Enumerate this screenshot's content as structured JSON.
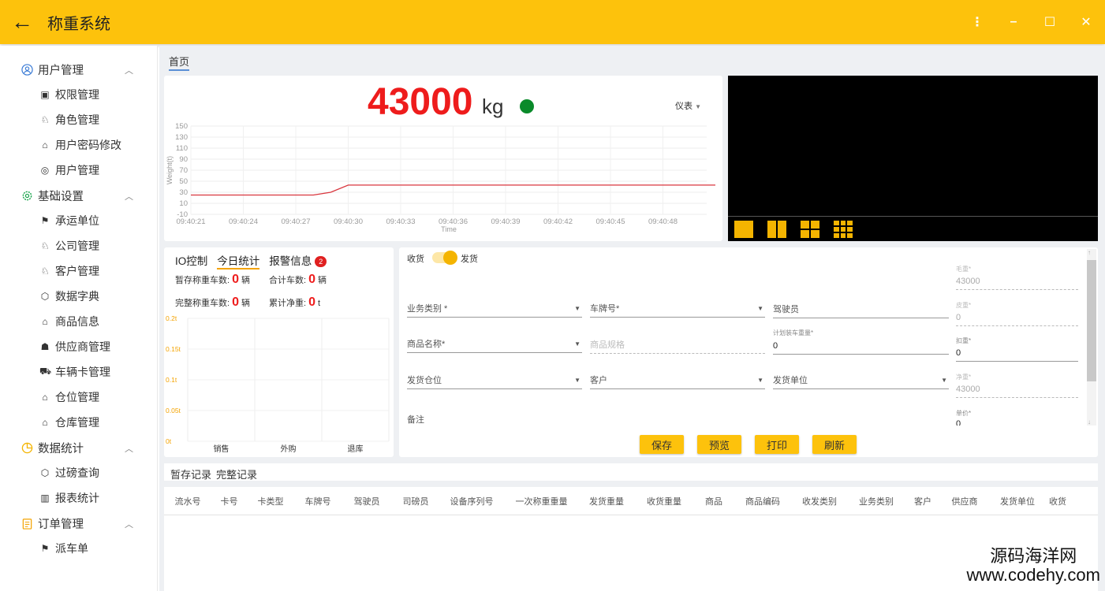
{
  "app": {
    "title": "称重系统"
  },
  "window_buttons": {
    "more": "⋮",
    "minimize": "–",
    "maximize": "☐",
    "close": "✕"
  },
  "sidebar": {
    "groups": [
      {
        "label": "用户管理",
        "items": [
          "权限管理",
          "角色管理",
          "用户密码修改",
          "用户管理"
        ]
      },
      {
        "label": "基础设置",
        "items": [
          "承运单位",
          "公司管理",
          "客户管理",
          "数据字典",
          "商品信息",
          "供应商管理",
          "车辆卡管理",
          "仓位管理",
          "仓库管理"
        ]
      },
      {
        "label": "数据统计",
        "items": [
          "过磅查询",
          "报表统计"
        ]
      },
      {
        "label": "订单管理",
        "items": [
          "派车单"
        ]
      }
    ]
  },
  "home_tab": "首页",
  "weight": {
    "value": "43000",
    "unit": "kg",
    "status_color": "#0a8a2a",
    "meter_label": "仪表"
  },
  "chart_data": {
    "type": "line",
    "ylabel": "Weight(t)",
    "xlabel": "Time",
    "y_ticks": [
      "150",
      "130",
      "110",
      "90",
      "70",
      "50",
      "30",
      "10",
      "-10"
    ],
    "x_ticks": [
      "09:40:21",
      "09:40:24",
      "09:40:27",
      "09:40:30",
      "09:40:33",
      "09:40:36",
      "09:40:39",
      "09:40:42",
      "09:40:45",
      "09:40:48"
    ],
    "ylim": [
      -10,
      150
    ],
    "series": [
      {
        "color": "#d9363e",
        "x": [
          "09:40:21",
          "09:40:28",
          "09:40:29",
          "09:40:30",
          "09:40:51"
        ],
        "y": [
          25,
          25,
          30,
          43,
          43
        ]
      }
    ]
  },
  "stats": {
    "tabs": [
      "IO控制",
      "今日统计",
      "报警信息"
    ],
    "alarm_count": "2",
    "temp_label": "暂存称重车数:",
    "temp_value": "0",
    "temp_unit": "辆",
    "total_label": "合计车数:",
    "total_value": "0",
    "total_unit": "辆",
    "done_label": "完整称重车数:",
    "done_value": "0",
    "done_unit": "辆",
    "net_label": "累计净重:",
    "net_value": "0",
    "net_unit": "t",
    "y_ticks": [
      "0.2t",
      "0.15t",
      "0.1t",
      "0.05t",
      "0t"
    ],
    "categories": [
      "销售",
      "外购",
      "退库"
    ]
  },
  "form": {
    "receive": "收货",
    "ship": "发货",
    "business_type": "业务类别 *",
    "plate": "车牌号*",
    "driver": "驾驶员",
    "goods_name": "商品名称*",
    "goods_spec": "商品规格",
    "plan_weight_label": "计划装车重量*",
    "plan_weight": "0",
    "ship_position": "发货仓位",
    "customer": "客户",
    "ship_unit": "发货单位",
    "remark": "备注",
    "gross_label": "毛重*",
    "gross": "43000",
    "tare_label": "皮重*",
    "tare": "0",
    "deduct_label": "扣重*",
    "deduct": "0",
    "net_label": "净重*",
    "net": "43000",
    "price_label": "单价*",
    "price": "0",
    "buttons": {
      "save": "保存",
      "preview": "预览",
      "print": "打印",
      "refresh": "刷新"
    }
  },
  "records": {
    "tabs": [
      "暂存记录",
      "完整记录"
    ],
    "columns": [
      "流水号",
      "卡号",
      "卡类型",
      "车牌号",
      "驾驶员",
      "司磅员",
      "设备序列号",
      "一次称重重量",
      "发货重量",
      "收货重量",
      "商品",
      "商品编码",
      "收发类别",
      "业务类别",
      "客户",
      "供应商",
      "发货单位",
      "收货"
    ]
  },
  "watermark": {
    "line1": "源码海洋网",
    "line2": "www.codehy.com"
  }
}
